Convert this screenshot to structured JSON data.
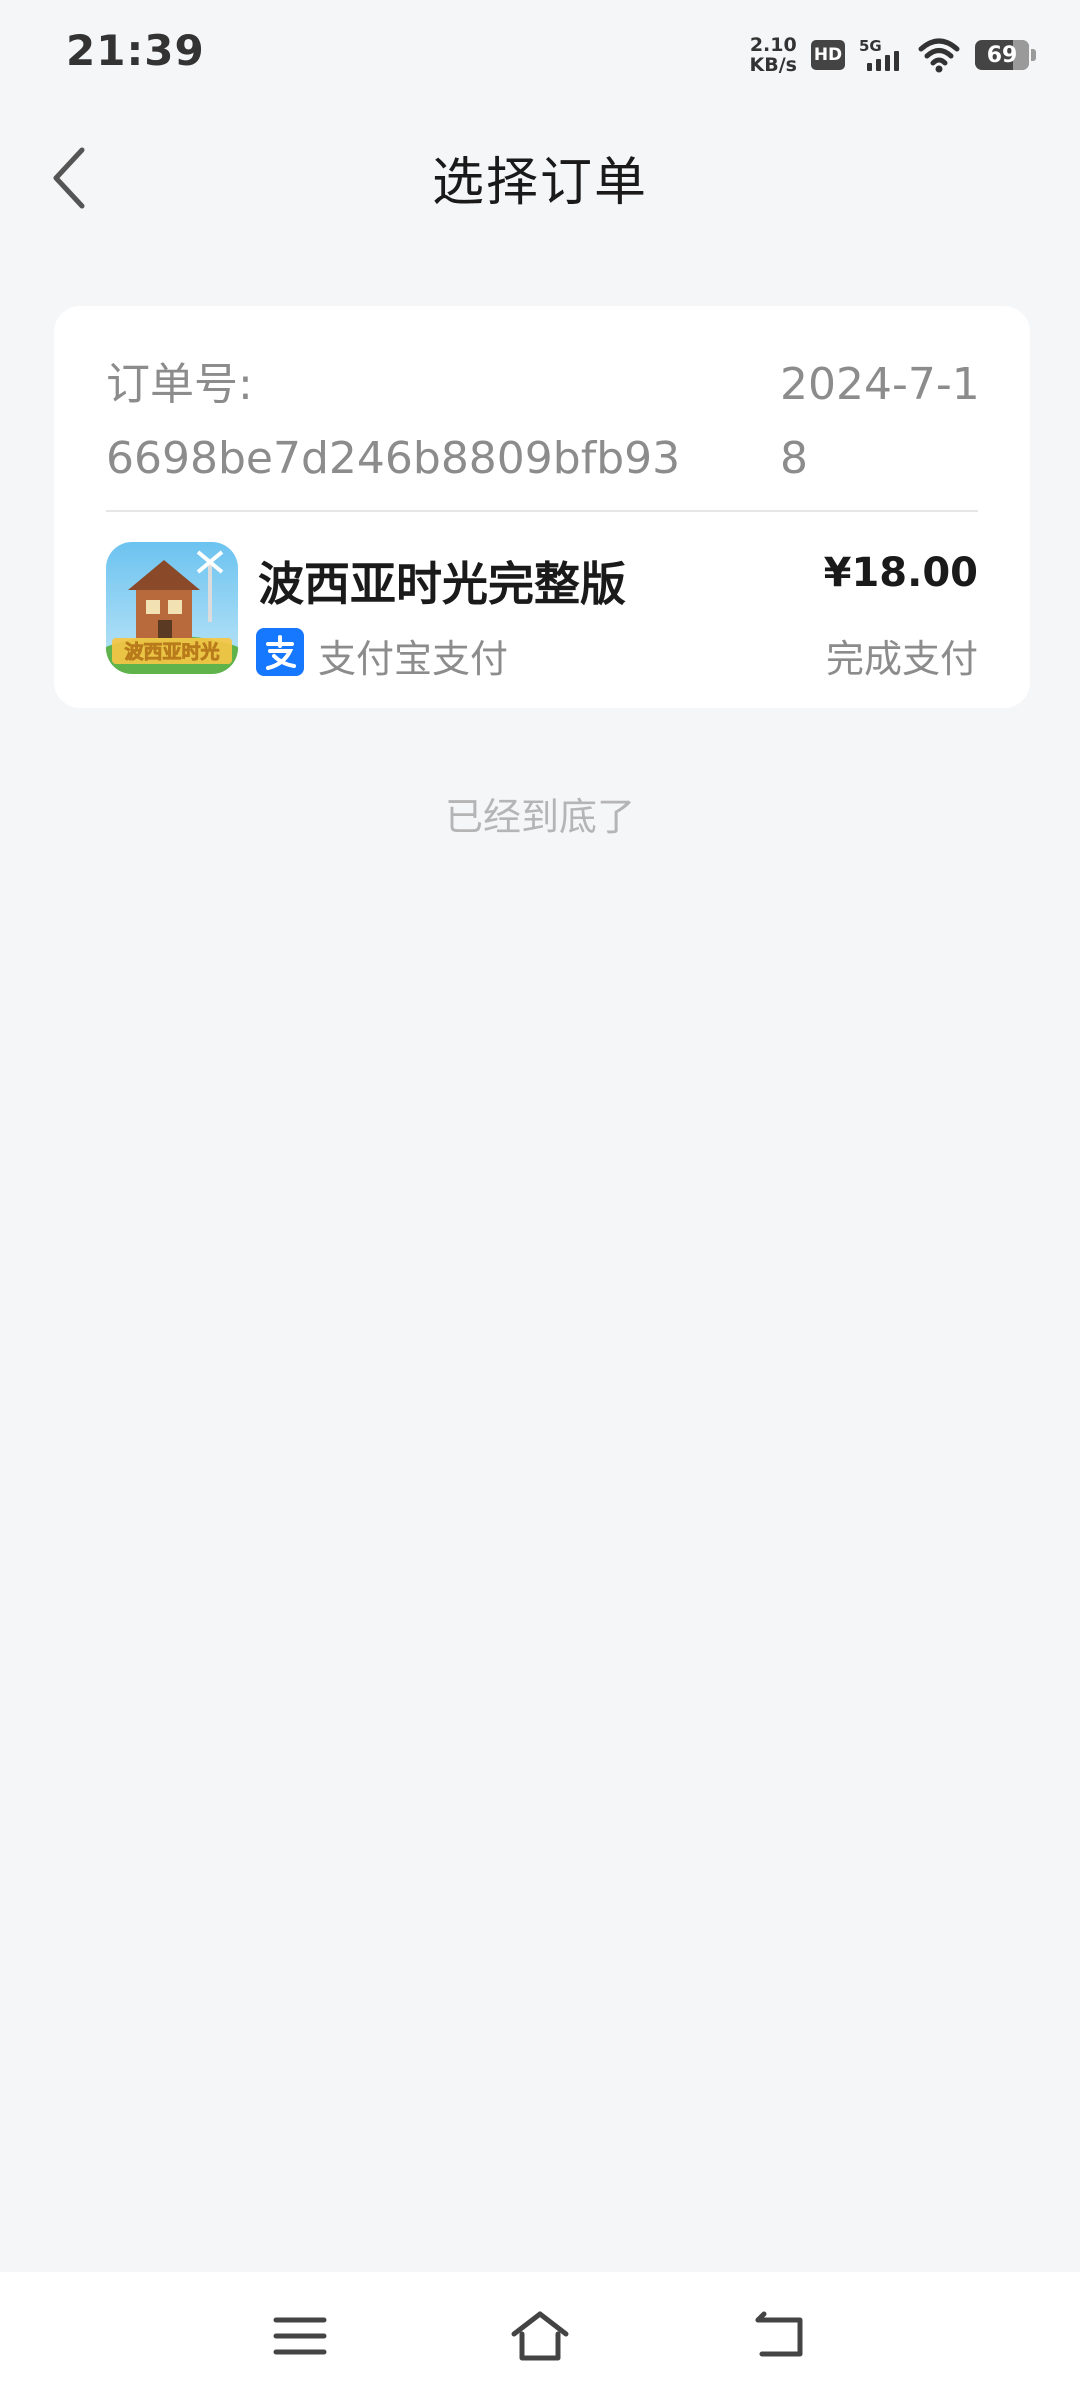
{
  "status_bar": {
    "time": "21:39",
    "net_speed_value": "2.10",
    "net_speed_unit": "KB/s",
    "hd": "HD",
    "network": "5G",
    "battery": "69"
  },
  "header": {
    "title": "选择订单"
  },
  "order": {
    "id_label": "订单号:",
    "id_value": "6698be7d246b8809bfb93",
    "date": "2024-7-18",
    "product_name": "波西亚时光完整版",
    "price": "¥18.00",
    "payment_method": "支付宝支付",
    "payment_status": "完成支付",
    "icon_text": "波西亚时光"
  },
  "list_end_text": "已经到底了",
  "colors": {
    "background": "#f5f6f8",
    "card": "#ffffff",
    "alipay_blue": "#1677ff",
    "secondary_text": "#8c8c8c"
  }
}
